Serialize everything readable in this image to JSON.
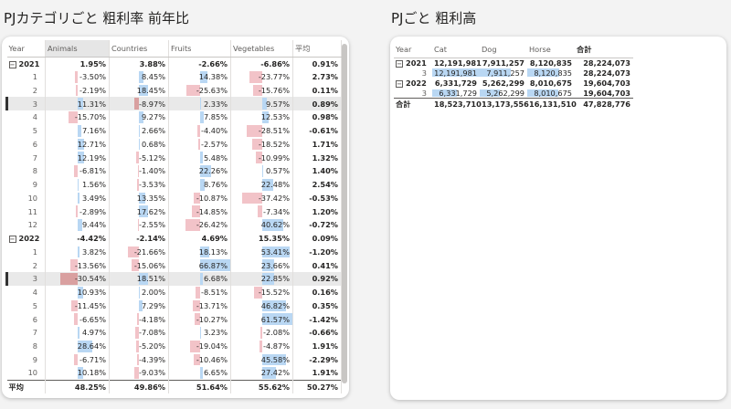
{
  "visual1": {
    "title": "PJカテゴリごと 粗利率 前年比",
    "headers": [
      "Year",
      "Animals",
      "Countries",
      "Fruits",
      "Vegetables",
      "平均"
    ],
    "rows": [
      {
        "kind": "year",
        "label": "2021",
        "values": [
          "1.95%",
          "3.88%",
          "-2.66%",
          "-6.86%"
        ],
        "avg": "0.91%"
      },
      {
        "kind": "month",
        "label": "1",
        "values": [
          "-3.50%",
          "8.45%",
          "14.38%",
          "-23.77%"
        ],
        "avg": "2.73%"
      },
      {
        "kind": "month",
        "label": "2",
        "values": [
          "-2.19%",
          "18.45%",
          "-25.63%",
          "-15.76%"
        ],
        "avg": "0.11%"
      },
      {
        "kind": "month",
        "label": "3",
        "selected": true,
        "values": [
          "11.31%",
          "-8.97%",
          "2.33%",
          "9.57%"
        ],
        "avg": "0.89%"
      },
      {
        "kind": "month",
        "label": "4",
        "values": [
          "-15.70%",
          "9.27%",
          "7.85%",
          "12.53%"
        ],
        "avg": "0.98%"
      },
      {
        "kind": "month",
        "label": "5",
        "values": [
          "7.16%",
          "2.66%",
          "-4.40%",
          "-28.51%"
        ],
        "avg": "-0.61%"
      },
      {
        "kind": "month",
        "label": "6",
        "values": [
          "12.71%",
          "0.68%",
          "-2.57%",
          "-18.52%"
        ],
        "avg": "1.71%"
      },
      {
        "kind": "month",
        "label": "7",
        "values": [
          "12.19%",
          "-5.12%",
          "5.48%",
          "-10.99%"
        ],
        "avg": "1.32%"
      },
      {
        "kind": "month",
        "label": "8",
        "values": [
          "-6.81%",
          "-1.40%",
          "22.26%",
          "0.57%"
        ],
        "avg": "1.40%"
      },
      {
        "kind": "month",
        "label": "9",
        "values": [
          "1.56%",
          "-3.53%",
          "8.76%",
          "22.48%"
        ],
        "avg": "2.54%"
      },
      {
        "kind": "month",
        "label": "10",
        "values": [
          "3.49%",
          "13.35%",
          "-10.87%",
          "-37.42%"
        ],
        "avg": "-0.53%"
      },
      {
        "kind": "month",
        "label": "11",
        "values": [
          "-2.89%",
          "17.62%",
          "-14.85%",
          "-7.34%"
        ],
        "avg": "1.20%"
      },
      {
        "kind": "month",
        "label": "12",
        "values": [
          "9.44%",
          "-2.55%",
          "-26.42%",
          "40.62%"
        ],
        "avg": "-0.72%"
      },
      {
        "kind": "year",
        "label": "2022",
        "values": [
          "-4.42%",
          "-2.14%",
          "4.69%",
          "15.35%"
        ],
        "avg": "0.09%"
      },
      {
        "kind": "month",
        "label": "1",
        "values": [
          "3.82%",
          "-21.66%",
          "18.13%",
          "53.41%"
        ],
        "avg": "-1.20%"
      },
      {
        "kind": "month",
        "label": "2",
        "values": [
          "-13.56%",
          "-15.06%",
          "66.87%",
          "23.66%"
        ],
        "avg": "0.41%"
      },
      {
        "kind": "month",
        "label": "3",
        "selected": true,
        "values": [
          "-30.54%",
          "18.51%",
          "6.68%",
          "22.85%"
        ],
        "avg": "0.92%"
      },
      {
        "kind": "month",
        "label": "4",
        "values": [
          "10.93%",
          "2.00%",
          "-8.51%",
          "-15.52%"
        ],
        "avg": "0.16%"
      },
      {
        "kind": "month",
        "label": "5",
        "values": [
          "-11.45%",
          "7.29%",
          "-13.71%",
          "46.82%"
        ],
        "avg": "0.35%"
      },
      {
        "kind": "month",
        "label": "6",
        "values": [
          "-6.65%",
          "-4.18%",
          "-10.27%",
          "61.57%"
        ],
        "avg": "-1.42%"
      },
      {
        "kind": "month",
        "label": "7",
        "values": [
          "4.97%",
          "-7.08%",
          "3.23%",
          "-2.08%"
        ],
        "avg": "-0.66%"
      },
      {
        "kind": "month",
        "label": "8",
        "values": [
          "28.64%",
          "-5.20%",
          "-19.04%",
          "-4.87%"
        ],
        "avg": "1.91%"
      },
      {
        "kind": "month",
        "label": "9",
        "values": [
          "-6.71%",
          "-4.39%",
          "-10.46%",
          "45.58%"
        ],
        "avg": "-2.29%"
      },
      {
        "kind": "month",
        "label": "10",
        "values": [
          "10.18%",
          "-9.03%",
          "6.65%",
          "27.42%"
        ],
        "avg": "1.91%"
      }
    ],
    "total": {
      "label": "平均",
      "values": [
        "48.25%",
        "49.86%",
        "51.64%",
        "55.62%"
      ],
      "avg": "50.27%"
    },
    "colors": {
      "positive_bar": "#b9d7f3",
      "negative_bar": "#f2c3c8",
      "selection": "#e9e9e9"
    }
  },
  "visual2": {
    "title": "PJごと 粗利高",
    "headers": [
      "Year",
      "Cat",
      "Dog",
      "Horse",
      "合計"
    ],
    "rows": [
      {
        "kind": "year",
        "label": "2021",
        "values": [
          "12,191,981",
          "7,911,257",
          "8,120,835"
        ],
        "total": "28,224,073"
      },
      {
        "kind": "month",
        "label": "3",
        "values": [
          "12,191,981",
          "7,911,257",
          "8,120,835"
        ],
        "total": "28,224,073",
        "bar_ratio": [
          1.0,
          0.65,
          0.67
        ]
      },
      {
        "kind": "year",
        "label": "2022",
        "values": [
          "6,331,729",
          "5,262,299",
          "8,010,675"
        ],
        "total": "19,604,703"
      },
      {
        "kind": "month",
        "label": "3",
        "values": [
          "6,331,729",
          "5,262,299",
          "8,010,675"
        ],
        "total": "19,604,703",
        "bar_ratio": [
          0.52,
          0.43,
          0.66
        ]
      }
    ],
    "total": {
      "label": "合計",
      "values": [
        "18,523,710",
        "13,173,556",
        "16,131,510"
      ],
      "total": "47,828,776"
    }
  },
  "icons": {
    "collapse": "minus-box-icon"
  }
}
